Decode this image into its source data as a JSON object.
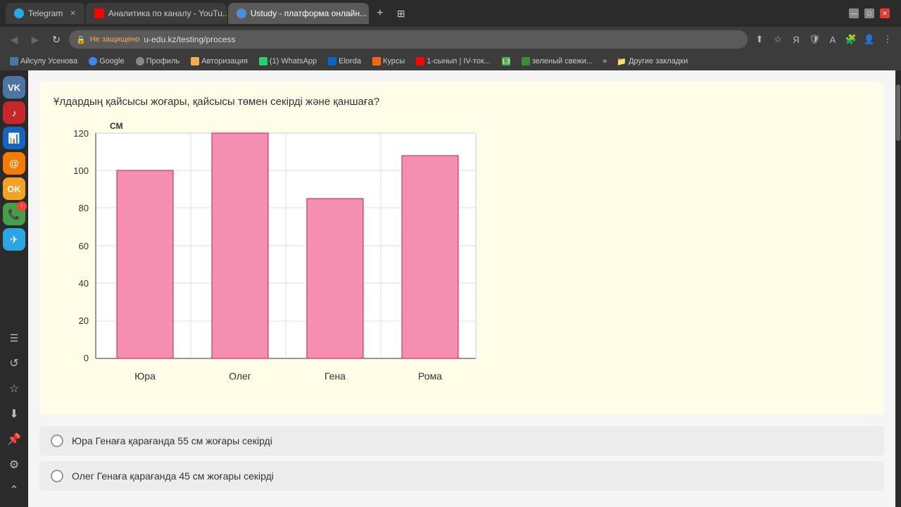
{
  "browser": {
    "tabs": [
      {
        "id": "telegram",
        "label": "Telegram",
        "icon": "telegram",
        "active": false
      },
      {
        "id": "youtube",
        "label": "Аналитика по каналу - YouTu...",
        "icon": "youtube",
        "active": false
      },
      {
        "id": "ustudy",
        "label": "Ustudy - платформа онлайн...",
        "icon": "ustudy",
        "active": true
      }
    ],
    "address": "u-edu.kz/testing/process",
    "address_prefix": "Не защищено",
    "bookmarks": [
      {
        "label": "Айсулу Усенова",
        "icon": "vk"
      },
      {
        "label": "Google",
        "icon": "google"
      },
      {
        "label": "Профиль",
        "icon": "profile"
      },
      {
        "label": "Авторизация",
        "icon": "auth"
      },
      {
        "label": "(1) WhatsApp",
        "icon": "whatsapp"
      },
      {
        "label": "Elorda",
        "icon": "elorda"
      },
      {
        "label": "Курсы",
        "icon": "kursy"
      },
      {
        "label": "1-сынып | IV-ток...",
        "icon": "youtube"
      },
      {
        "label": "1.3",
        "icon": "num"
      },
      {
        "label": "зеленый свежи...",
        "icon": "green"
      }
    ],
    "other_bookmarks": "Другие закладки"
  },
  "sidebar": {
    "icons": [
      {
        "name": "vk",
        "label": "VK",
        "type": "vk"
      },
      {
        "name": "music",
        "label": "Music",
        "type": "music"
      },
      {
        "name": "analytics",
        "label": "Analytics",
        "type": "analytics"
      },
      {
        "name": "mail",
        "label": "Mail",
        "type": "mail"
      },
      {
        "name": "ok",
        "label": "OK",
        "type": "ok"
      },
      {
        "name": "phone",
        "label": "Phone",
        "type": "phone"
      },
      {
        "name": "telegram",
        "label": "Telegram",
        "type": "telegram"
      },
      {
        "name": "list",
        "label": "List",
        "type": "list"
      },
      {
        "name": "history",
        "label": "History",
        "type": "history"
      },
      {
        "name": "star",
        "label": "Favorites",
        "type": "star"
      },
      {
        "name": "download",
        "label": "Download",
        "type": "download"
      },
      {
        "name": "pin",
        "label": "Pin",
        "type": "pin"
      },
      {
        "name": "settings",
        "label": "Settings",
        "type": "settings"
      },
      {
        "name": "collapse",
        "label": "Collapse",
        "type": "collapse"
      }
    ]
  },
  "question": {
    "text": "Ұлдардың қайсысы жоғары, қайсысы төмен секірді және қаншаға?",
    "chart": {
      "y_axis_label": "СМ",
      "y_ticks": [
        0,
        20,
        40,
        60,
        80,
        100,
        120
      ],
      "bars": [
        {
          "label": "Юра",
          "value": 100
        },
        {
          "label": "Олег",
          "value": 120
        },
        {
          "label": "Гена",
          "value": 85
        },
        {
          "label": "Рома",
          "value": 108
        }
      ]
    },
    "answers": [
      {
        "id": "a1",
        "text": "Юра Генаға қарағанда 55 см жоғары секірді"
      },
      {
        "id": "a2",
        "text": "Олег Генаға қарағанда 45 см жоғары секірді"
      }
    ]
  }
}
